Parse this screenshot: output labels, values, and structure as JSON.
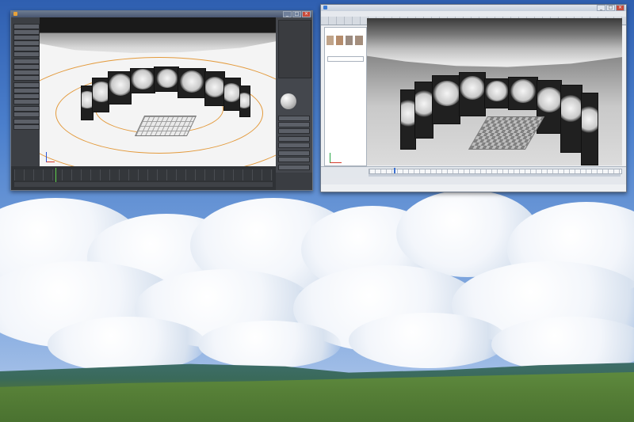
{
  "left_window": {
    "title": "",
    "sidebar_label": "",
    "tool_buttons": 20,
    "timeline_label": ""
  },
  "right_window": {
    "title": "",
    "menu": [
      "",
      "",
      "",
      "",
      "",
      "",
      "",
      "",
      "",
      ""
    ],
    "panel_title": "",
    "tree_items": [
      "",
      "",
      "",
      "",
      "",
      "",
      "",
      "",
      "",
      "",
      "",
      "",
      ""
    ],
    "statusbar_text": ""
  },
  "colors": {
    "sky_top": "#2f5fb0",
    "sky_bottom": "#b9cdeb",
    "grass": "#567f37",
    "grid_orange": "#e39a3c",
    "window_chrome": "#3b4862"
  },
  "icons": [
    "minimize-icon",
    "maximize-icon",
    "close-icon",
    "app-icon"
  ]
}
